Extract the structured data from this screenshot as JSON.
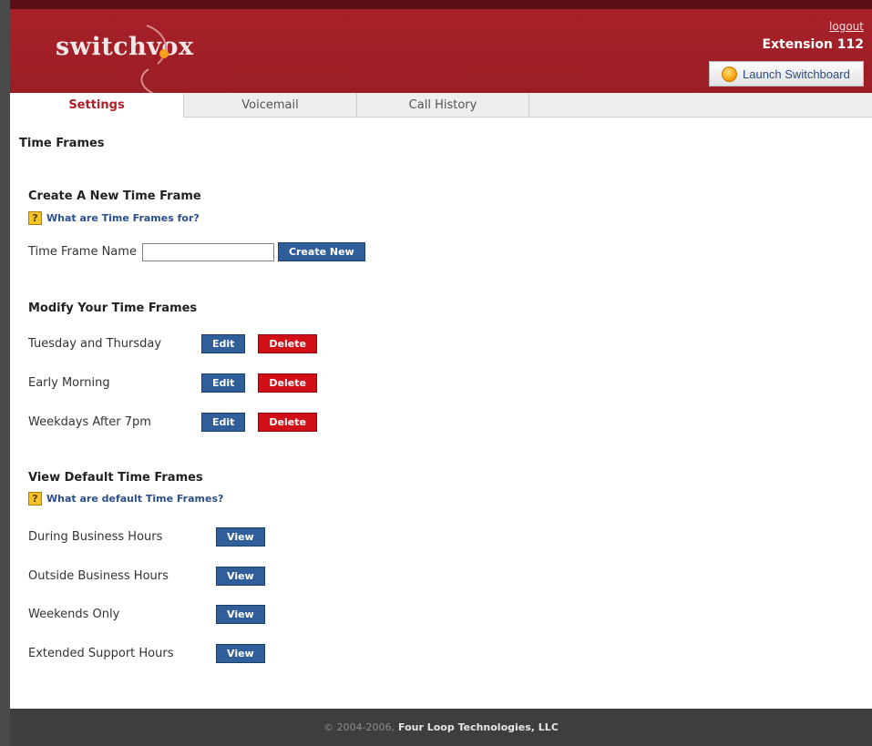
{
  "header": {
    "logo_text": "switchvox",
    "logout_label": "logout",
    "extension_label": "Extension 112",
    "launch_button_label": "Launch Switchboard"
  },
  "tabs": [
    {
      "label": "Settings",
      "active": true
    },
    {
      "label": "Voicemail",
      "active": false
    },
    {
      "label": "Call History",
      "active": false
    }
  ],
  "page_title": "Time Frames",
  "create_section": {
    "heading": "Create A New Time Frame",
    "help_link": "What are Time Frames for?",
    "name_label": "Time Frame Name",
    "name_value": "",
    "create_button": "Create New"
  },
  "modify_section": {
    "heading": "Modify Your Time Frames",
    "edit_label": "Edit",
    "delete_label": "Delete",
    "items": [
      {
        "name": "Tuesday and Thursday"
      },
      {
        "name": "Early Morning"
      },
      {
        "name": "Weekdays After 7pm"
      }
    ]
  },
  "default_section": {
    "heading": "View Default Time Frames",
    "help_link": "What are default Time Frames?",
    "view_label": "View",
    "items": [
      {
        "name": "During Business Hours"
      },
      {
        "name": "Outside Business Hours"
      },
      {
        "name": "Weekends Only"
      },
      {
        "name": "Extended Support Hours"
      }
    ]
  },
  "footer": {
    "copyright": "© 2004-2006,",
    "company": "Four Loop Technologies, LLC"
  },
  "colors": {
    "header_red": "#a8212a",
    "tab_active": "#b01e28",
    "button_blue": "#2f5e98",
    "button_red": "#d10f17",
    "footer_bg": "#3e3e3e"
  }
}
